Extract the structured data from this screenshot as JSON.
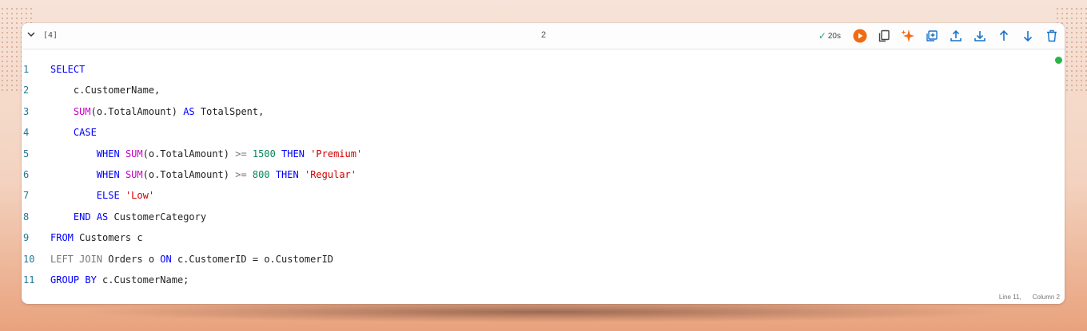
{
  "cell": {
    "exec_count": "[4]",
    "language_label": "2",
    "status": {
      "check": "✓",
      "duration": "20s"
    },
    "action_icons": [
      "run-icon",
      "copy-icon",
      "sparkle-icon",
      "add-cell-icon",
      "upload-icon",
      "download-icon",
      "move-up-icon",
      "move-down-icon",
      "delete-icon"
    ],
    "colors": {
      "run_orange": "#f26a12",
      "sparkle_orange": "#f26a12",
      "icon_blue": "#1a73c9",
      "success": "#2db34a"
    }
  },
  "code": {
    "lines": [
      {
        "n": "1",
        "tokens": [
          {
            "t": "SELECT",
            "c": "kw"
          }
        ]
      },
      {
        "n": "2",
        "tokens": [
          {
            "t": "    c.CustomerName,",
            "c": ""
          }
        ]
      },
      {
        "n": "3",
        "tokens": [
          {
            "t": "    ",
            "c": ""
          },
          {
            "t": "SUM",
            "c": "fn"
          },
          {
            "t": "(o.TotalAmount) ",
            "c": ""
          },
          {
            "t": "AS",
            "c": "kw"
          },
          {
            "t": " TotalSpent,",
            "c": ""
          }
        ]
      },
      {
        "n": "4",
        "tokens": [
          {
            "t": "    ",
            "c": ""
          },
          {
            "t": "CASE",
            "c": "kw"
          }
        ]
      },
      {
        "n": "5",
        "tokens": [
          {
            "t": "        ",
            "c": ""
          },
          {
            "t": "WHEN",
            "c": "kw"
          },
          {
            "t": " ",
            "c": ""
          },
          {
            "t": "SUM",
            "c": "fn"
          },
          {
            "t": "(o.TotalAmount) ",
            "c": ""
          },
          {
            "t": ">=",
            "c": "op"
          },
          {
            "t": " ",
            "c": ""
          },
          {
            "t": "1500",
            "c": "num"
          },
          {
            "t": " ",
            "c": ""
          },
          {
            "t": "THEN",
            "c": "kw"
          },
          {
            "t": " ",
            "c": ""
          },
          {
            "t": "'Premium'",
            "c": "str"
          }
        ]
      },
      {
        "n": "6",
        "tokens": [
          {
            "t": "        ",
            "c": ""
          },
          {
            "t": "WHEN",
            "c": "kw"
          },
          {
            "t": " ",
            "c": ""
          },
          {
            "t": "SUM",
            "c": "fn"
          },
          {
            "t": "(o.TotalAmount) ",
            "c": ""
          },
          {
            "t": ">=",
            "c": "op"
          },
          {
            "t": " ",
            "c": ""
          },
          {
            "t": "800",
            "c": "num"
          },
          {
            "t": " ",
            "c": ""
          },
          {
            "t": "THEN",
            "c": "kw"
          },
          {
            "t": " ",
            "c": ""
          },
          {
            "t": "'Regular'",
            "c": "str"
          }
        ]
      },
      {
        "n": "7",
        "tokens": [
          {
            "t": "        ",
            "c": ""
          },
          {
            "t": "ELSE",
            "c": "kw"
          },
          {
            "t": " ",
            "c": ""
          },
          {
            "t": "'Low'",
            "c": "str"
          }
        ]
      },
      {
        "n": "8",
        "tokens": [
          {
            "t": "    ",
            "c": ""
          },
          {
            "t": "END",
            "c": "kw"
          },
          {
            "t": " ",
            "c": ""
          },
          {
            "t": "AS",
            "c": "kw"
          },
          {
            "t": " CustomerCategory",
            "c": ""
          }
        ]
      },
      {
        "n": "9",
        "tokens": [
          {
            "t": "FROM",
            "c": "kw"
          },
          {
            "t": " Customers c",
            "c": ""
          }
        ]
      },
      {
        "n": "10",
        "tokens": [
          {
            "t": "LEFT JOIN",
            "c": "kwg"
          },
          {
            "t": " Orders o ",
            "c": ""
          },
          {
            "t": "ON",
            "c": "kw"
          },
          {
            "t": " c.CustomerID = o.CustomerID",
            "c": ""
          }
        ]
      },
      {
        "n": "11",
        "tokens": [
          {
            "t": "GROUP BY",
            "c": "kw"
          },
          {
            "t": " c.CustomerName;",
            "c": ""
          }
        ]
      }
    ]
  },
  "footer": {
    "line": "Line 11,",
    "column": "Column 2"
  }
}
